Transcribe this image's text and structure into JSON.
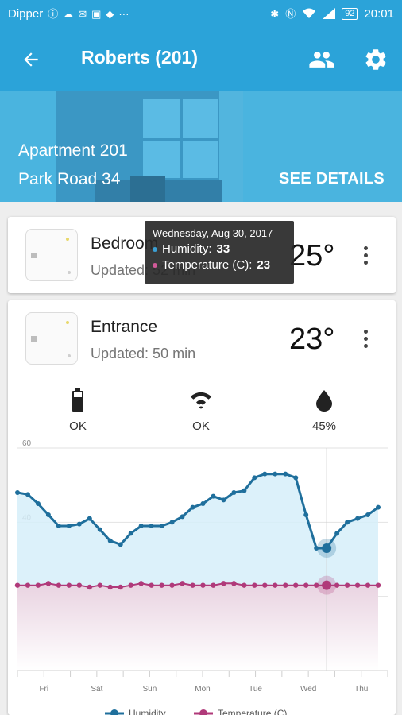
{
  "status_bar": {
    "carrier": "Dipper",
    "battery": "92",
    "time": "20:01"
  },
  "app_bar": {
    "title": "Roberts (201)",
    "back_icon": "arrow-back-icon",
    "people_icon": "people-icon",
    "settings_icon": "gear-icon"
  },
  "hero": {
    "line1": "Apartment 201",
    "line2": "Park Road 34",
    "action": "SEE DETAILS"
  },
  "rooms": [
    {
      "name": "Bedroom",
      "updated": "Updated: 52 min",
      "temperature": "25°"
    },
    {
      "name": "Entrance",
      "updated": "Updated: 50 min",
      "temperature": "23°"
    }
  ],
  "metrics": [
    {
      "icon": "battery-icon",
      "value": "OK"
    },
    {
      "icon": "wifi-icon",
      "value": "OK"
    },
    {
      "icon": "water-drop-icon",
      "value": "45%"
    }
  ],
  "colors": {
    "primary": "#2ba3d9",
    "humidity": "#1f6f9c",
    "temperature": "#b03a7a",
    "humidity_fill": "#d6eef9",
    "temperature_fill": "#f3e6ee"
  },
  "chart_data": {
    "type": "line",
    "categories": [
      "Fri",
      "Sat",
      "Sun",
      "Mon",
      "Tue",
      "Wed",
      "Thu"
    ],
    "ylim": [
      0,
      60
    ],
    "yticks": [
      0,
      20,
      40,
      60
    ],
    "grid": true,
    "series": [
      {
        "name": "Humidity",
        "values": [
          48,
          47.5,
          45,
          42,
          39,
          39,
          39.5,
          41,
          38,
          35,
          34,
          37,
          39,
          39,
          39,
          40,
          41.5,
          44,
          45,
          47,
          46,
          48,
          48.5,
          52,
          53,
          53,
          53,
          52,
          42,
          33,
          33,
          37,
          40,
          41,
          42,
          44
        ]
      },
      {
        "name": "Temperature (C)",
        "values": [
          23,
          23,
          23,
          23.5,
          23,
          23,
          23,
          22.5,
          23,
          22.5,
          22.5,
          23,
          23.5,
          23,
          23,
          23,
          23.5,
          23,
          23,
          23,
          23.5,
          23.5,
          23,
          23,
          23,
          23,
          23,
          23,
          23,
          23,
          23,
          23,
          23,
          23,
          23,
          23
        ]
      }
    ],
    "tooltip": {
      "date": "Wednesday, Aug 30, 2017",
      "rows": [
        {
          "label": "Humidity: ",
          "value": "33"
        },
        {
          "label": "Temperature (C): ",
          "value": "23"
        }
      ],
      "index": 30
    }
  }
}
